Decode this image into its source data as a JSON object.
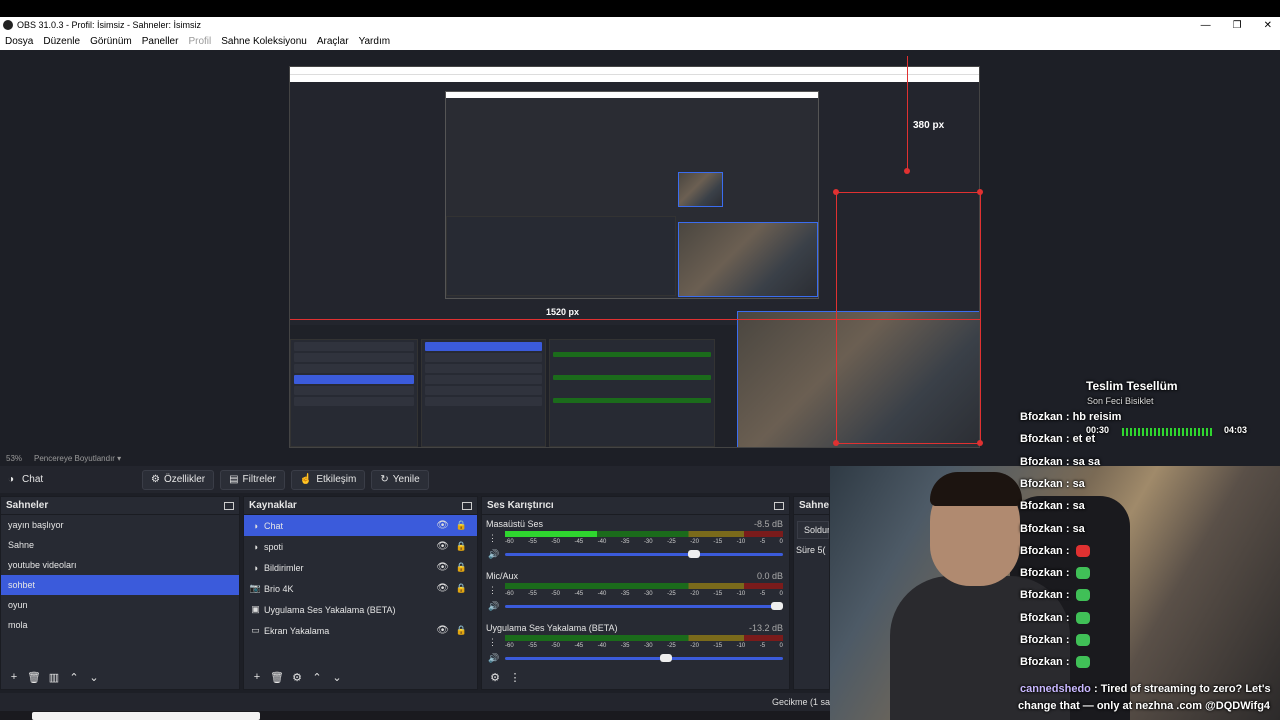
{
  "window": {
    "title": "OBS 31.0.3 - Profil: İsimsiz - Sahneler: İsimsiz",
    "controls": {
      "minimize": "—",
      "maximize": "❐",
      "close": "✕"
    }
  },
  "menu": {
    "items": [
      "Dosya",
      "Düzenle",
      "Görünüm",
      "Paneller",
      "Profil",
      "Sahne Koleksiyonu",
      "Araçlar",
      "Yardım"
    ]
  },
  "preview": {
    "zoom": "53%",
    "fit_label": "Pencereye Boyutlandır",
    "dim_width": "1520 px",
    "dim_height": "380 px"
  },
  "source_toolbar": {
    "current_source": "Chat",
    "properties": "Özellikler",
    "filters": "Filtreler",
    "interact": "Etkileşim",
    "refresh": "Yenile"
  },
  "scenes": {
    "title": "Sahneler",
    "items": [
      "yayın başlıyor",
      "Sahne",
      "youtube videoları",
      "sohbet",
      "oyun",
      "mola"
    ],
    "selected_index": 3
  },
  "sources": {
    "title": "Kaynaklar",
    "items": [
      {
        "name": "Chat",
        "icon": "browser-icon"
      },
      {
        "name": "spoti",
        "icon": "browser-icon"
      },
      {
        "name": "Bildirimler",
        "icon": "browser-icon"
      },
      {
        "name": "Brio 4K",
        "icon": "camera-icon"
      },
      {
        "name": "Uygulama Ses Yakalama (BETA)",
        "icon": "app-audio-icon"
      },
      {
        "name": "Ekran Yakalama",
        "icon": "monitor-icon"
      }
    ],
    "selected_index": 0
  },
  "mixer": {
    "title": "Ses Karıştırıcı",
    "tracks": [
      {
        "name": "Masaüstü Ses",
        "db": "-8.5 dB",
        "level": 0.33,
        "volume": 0.7
      },
      {
        "name": "Mic/Aux",
        "db": "0.0 dB",
        "level": 0.0,
        "volume": 1.0
      },
      {
        "name": "Uygulama Ses Yakalama (BETA)",
        "db": "-13.2 dB",
        "level": 0.0,
        "volume": 0.6
      }
    ],
    "ticks": [
      "-60",
      "-55",
      "-50",
      "-45",
      "-40",
      "-35",
      "-30",
      "-25",
      "-20",
      "-15",
      "-10",
      "-5",
      "0"
    ]
  },
  "transitions": {
    "title": "Sahne G",
    "fade": "Soldur",
    "duration_label": "Süre",
    "duration_value": "5("
  },
  "status": {
    "delay": "Gecikme (1 sa"
  },
  "overlay": {
    "song_title": "Teslim Tesellüm",
    "song_artist": "Son Feci Bisiklet",
    "time_current": "00:30",
    "time_total": "04:03",
    "chat": [
      {
        "user": "Bfozkan",
        "msg": "hb reisim"
      },
      {
        "user": "Bfozkan",
        "msg": "et et"
      },
      {
        "user": "Bfozkan",
        "msg": "sa sa"
      },
      {
        "user": "Bfozkan",
        "msg": "sa"
      },
      {
        "user": "Bfozkan",
        "msg": "sa"
      },
      {
        "user": "Bfozkan",
        "msg": "sa"
      },
      {
        "user": "Bfozkan",
        "msg": ""
      },
      {
        "user": "Bfozkan",
        "msg": ""
      },
      {
        "user": "Bfozkan",
        "msg": ""
      },
      {
        "user": "Bfozkan",
        "msg": ""
      },
      {
        "user": "Bfozkan",
        "msg": ""
      },
      {
        "user": "Bfozkan",
        "msg": ""
      }
    ],
    "promo_user": "cannedshedo",
    "promo_line1": "Tired of streaming to zero? Let's",
    "promo_line2": "change that — only at nezhna .com @DQDWifg4"
  },
  "colors": {
    "accent": "#3b5bdb",
    "meter_green": "#2fd62f",
    "guide_red": "#e03131"
  }
}
